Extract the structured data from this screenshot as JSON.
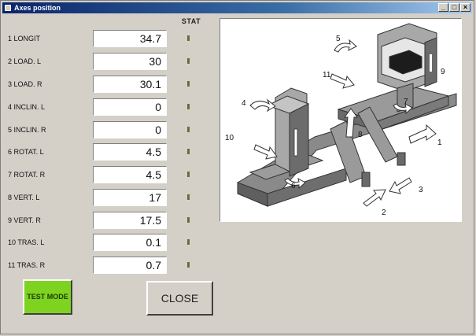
{
  "window": {
    "title": "Axes position",
    "minimize": "_",
    "maximize": "□",
    "close": "×"
  },
  "stat_header": "STAT",
  "rows": [
    {
      "label": "1 LONGIT",
      "value": "34.7"
    },
    {
      "label": "2 LOAD. L",
      "value": "30"
    },
    {
      "label": "3 LOAD. R",
      "value": "30.1"
    },
    {
      "label": "4 INCLIN. L",
      "value": "0"
    },
    {
      "label": "5 INCLIN. R",
      "value": "0"
    },
    {
      "label": "6 ROTAT. L",
      "value": "4.5"
    },
    {
      "label": "7 ROTAT. R",
      "value": "4.5"
    },
    {
      "label": "8 VERT. L",
      "value": "17"
    },
    {
      "label": "9 VERT. R",
      "value": "17.5"
    },
    {
      "label": "10 TRAS. L",
      "value": "0.1"
    },
    {
      "label": "11 TRAS. R",
      "value": "0.7"
    }
  ],
  "buttons": {
    "test_mode": "TEST MODE",
    "close": "CLOSE"
  },
  "diagram_labels": [
    "1",
    "2",
    "3",
    "4",
    "5",
    "6",
    "7",
    "8",
    "9",
    "10",
    "11"
  ],
  "colors": {
    "test_mode_bg": "#7ed321",
    "title_bar": "#0a246a",
    "window_bg": "#d4d0c8"
  }
}
